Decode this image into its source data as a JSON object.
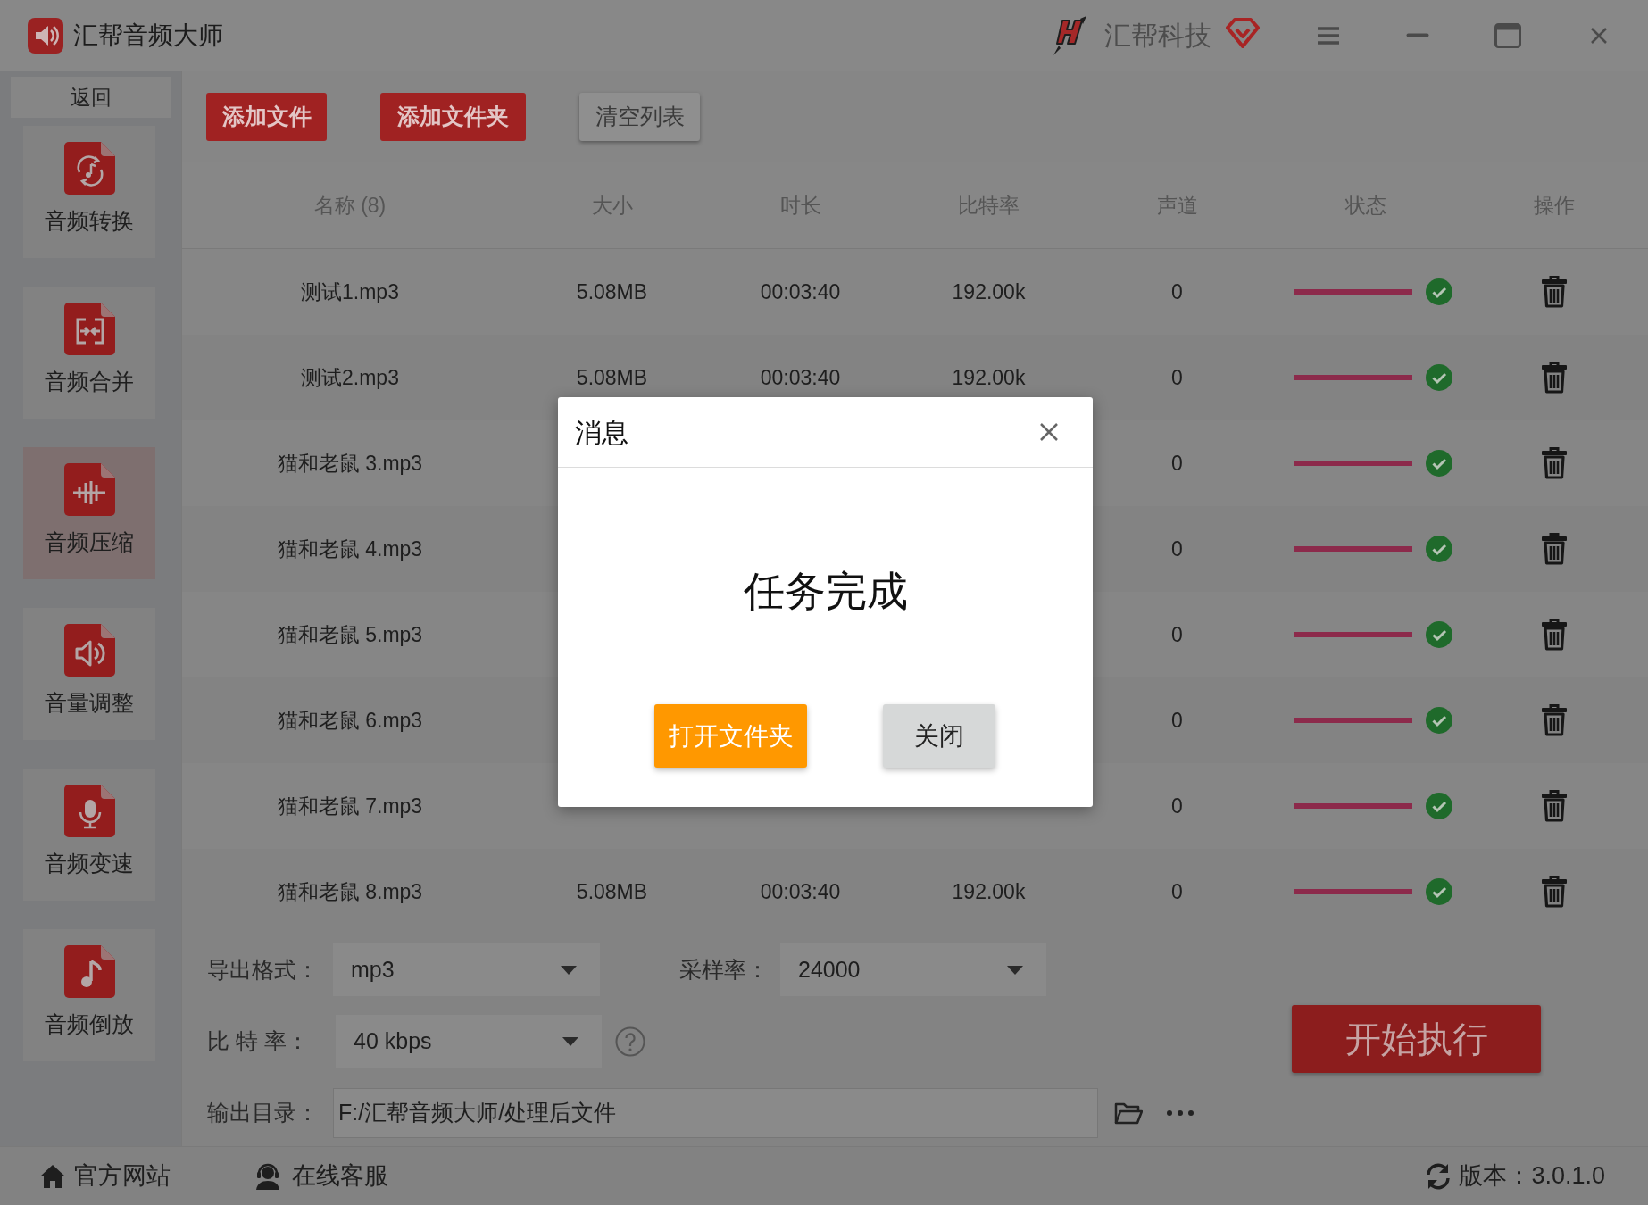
{
  "window": {
    "title": "汇帮音频大师",
    "brand": "汇帮科技"
  },
  "sidebar": {
    "back": "返回",
    "items": [
      {
        "kind": "convert",
        "label": "音频转换",
        "selected": false
      },
      {
        "kind": "merge",
        "label": "音频合并",
        "selected": false
      },
      {
        "kind": "compress",
        "label": "音频压缩",
        "selected": true
      },
      {
        "kind": "volume",
        "label": "音量调整",
        "selected": false
      },
      {
        "kind": "speed",
        "label": "音频变速",
        "selected": false
      },
      {
        "kind": "reverse",
        "label": "音频倒放",
        "selected": false
      }
    ]
  },
  "toolbar": {
    "buttons": [
      {
        "kind": "primary",
        "label": "添加文件"
      },
      {
        "kind": "primary",
        "label": "添加文件夹"
      },
      {
        "kind": "secondary",
        "label": "清空列表"
      }
    ]
  },
  "table": {
    "columns": [
      "名称 (8)",
      "大小",
      "时长",
      "比特率",
      "声道",
      "状态",
      "操作"
    ],
    "rows": [
      {
        "name": "测试1.mp3",
        "size": "5.08MB",
        "duration": "00:03:40",
        "bitrate": "192.00k",
        "channels": "0",
        "level": 1,
        "done": true
      },
      {
        "name": "测试2.mp3",
        "size": "5.08MB",
        "duration": "00:03:40",
        "bitrate": "192.00k",
        "channels": "0",
        "level": 1,
        "done": true
      },
      {
        "name": "猫和老鼠 3.mp3",
        "channels": "0",
        "level": 1,
        "done": true
      },
      {
        "name": "猫和老鼠 4.mp3",
        "channels": "0",
        "level": 1,
        "done": true
      },
      {
        "name": "猫和老鼠 5.mp3",
        "channels": "0",
        "level": 1,
        "done": true
      },
      {
        "name": "猫和老鼠 6.mp3",
        "channels": "0",
        "level": 1,
        "done": true
      },
      {
        "name": "猫和老鼠 7.mp3",
        "channels": "0",
        "level": 1,
        "done": true
      },
      {
        "name": "猫和老鼠 8.mp3",
        "size": "5.08MB",
        "duration": "00:03:40",
        "bitrate": "192.00k",
        "channels": "0",
        "level": 1,
        "done": true
      }
    ]
  },
  "dialog": {
    "title": "消息",
    "message": "任务完成",
    "buttons": [
      {
        "kind": "primary",
        "label": "打开文件夹"
      },
      {
        "kind": "secondary",
        "label": "关闭"
      }
    ]
  },
  "settings": {
    "export_format": {
      "label": "导出格式：",
      "value": "mp3"
    },
    "sample_rate": {
      "label": "采样率：",
      "value": "24000"
    },
    "bitrate": {
      "label": "比 特 率：",
      "value": "40 kbps"
    },
    "output_dir": {
      "label": "输出目录：",
      "value": "F:/汇帮音频大师/处理后文件"
    },
    "start_button": "开始执行"
  },
  "status_bar": {
    "website": "官方网站",
    "support": "在线客服",
    "version": "版本：3.0.1.0"
  }
}
